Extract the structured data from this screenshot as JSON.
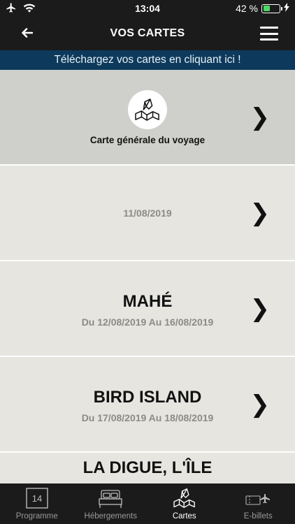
{
  "status_bar": {
    "time": "13:04",
    "battery": "42 %",
    "battery_level": 0.42,
    "icons": [
      "airplane-icon",
      "wifi-icon",
      "battery-icon",
      "charging-icon"
    ]
  },
  "header": {
    "title": "VOS CARTES",
    "back_icon": "arrow-left-icon",
    "menu_icon": "hamburger-menu-icon"
  },
  "banner": {
    "text": "Téléchargez vos cartes en cliquant ici !"
  },
  "maps": [
    {
      "label": "Carte générale du voyage",
      "icon": "map-icon"
    },
    {
      "title": "",
      "dates": "11/08/2019"
    },
    {
      "title": "MAHÉ",
      "dates": "Du 12/08/2019 Au 16/08/2019"
    },
    {
      "title": "BIRD ISLAND",
      "dates": "Du 17/08/2019 Au 18/08/2019"
    },
    {
      "title": "LA DIGUE, L'ÎLE",
      "dates": ""
    }
  ],
  "chevron": "❯",
  "tabs": [
    {
      "label": "Programme",
      "icon": "calendar-icon",
      "badge": "14"
    },
    {
      "label": "Hébergements",
      "icon": "bed-icon"
    },
    {
      "label": "Cartes",
      "icon": "map-icon",
      "active": true
    },
    {
      "label": "E-billets",
      "icon": "ticket-plane-icon"
    }
  ],
  "colors": {
    "bar_background": "#1b1b1b",
    "banner_background": "#0d3a5c",
    "card_background": "#e6e5e0",
    "selected_card_background": "#cfcfcb",
    "battery_green": "#4cd964"
  }
}
